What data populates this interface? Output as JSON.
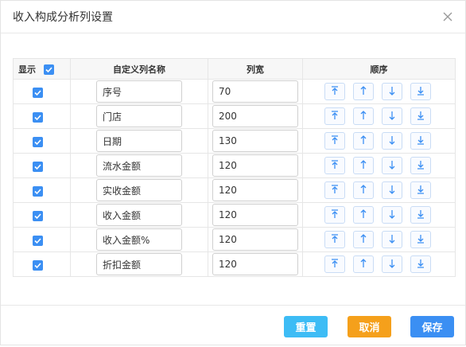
{
  "dialog": {
    "title": "收入构成分析列设置"
  },
  "table": {
    "headers": {
      "show": "显示",
      "name": "自定义列名称",
      "width": "列宽",
      "order": "顺序"
    },
    "rows": [
      {
        "checked": true,
        "name": "序号",
        "width": "70"
      },
      {
        "checked": true,
        "name": "门店",
        "width": "200"
      },
      {
        "checked": true,
        "name": "日期",
        "width": "130"
      },
      {
        "checked": true,
        "name": "流水金额",
        "width": "120"
      },
      {
        "checked": true,
        "name": "实收金额",
        "width": "120"
      },
      {
        "checked": true,
        "name": "收入金额",
        "width": "120"
      },
      {
        "checked": true,
        "name": "收入金额%",
        "width": "120"
      },
      {
        "checked": true,
        "name": "折扣金额",
        "width": "120"
      }
    ],
    "order_icons": [
      "move-to-top-icon",
      "move-up-icon",
      "move-down-icon",
      "move-to-bottom-icon"
    ]
  },
  "footer": {
    "reset_label": "重置",
    "cancel_label": "取消",
    "save_label": "保存"
  },
  "colors": {
    "checkbox": "#3b8ff3",
    "reset": "#3dbcf5",
    "cancel": "#f5a01b",
    "save": "#3b8ff3",
    "order_arrow": "#3b8ff3"
  }
}
